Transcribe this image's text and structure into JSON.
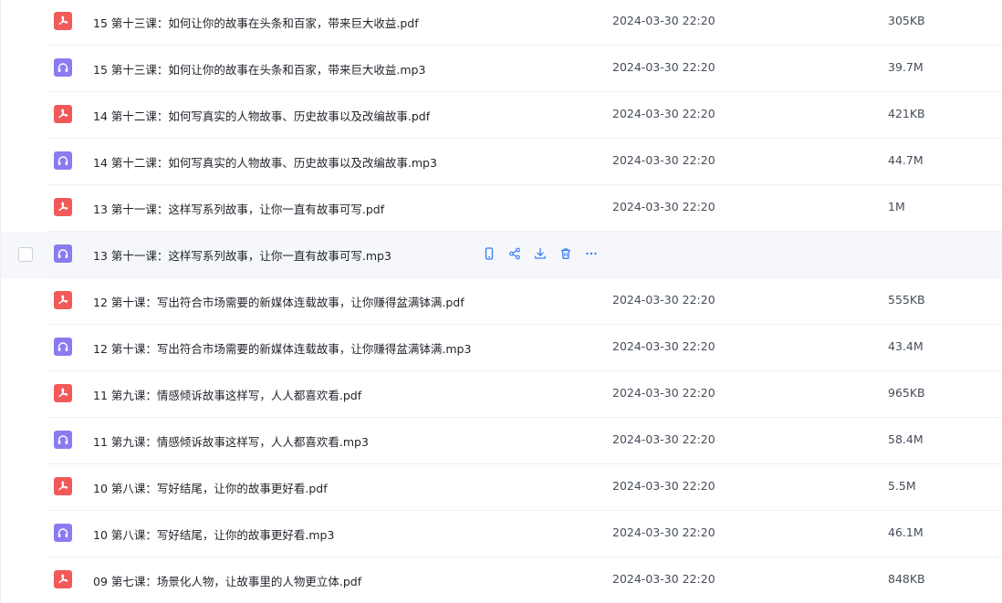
{
  "colors": {
    "pdf_icon": "#f25a5a",
    "audio_icon": "#8a7cf0",
    "action_icon": "#3a7df5"
  },
  "files": [
    {
      "name": "15 第十三课：如何让你的故事在头条和百家，带来巨大收益.pdf",
      "type": "pdf",
      "date": "2024-03-30 22:20",
      "size": "305KB"
    },
    {
      "name": "15 第十三课：如何让你的故事在头条和百家，带来巨大收益.mp3",
      "type": "audio",
      "date": "2024-03-30 22:20",
      "size": "39.7M"
    },
    {
      "name": "14 第十二课：如何写真实的人物故事、历史故事以及改编故事.pdf",
      "type": "pdf",
      "date": "2024-03-30 22:20",
      "size": "421KB"
    },
    {
      "name": "14 第十二课：如何写真实的人物故事、历史故事以及改编故事.mp3",
      "type": "audio",
      "date": "2024-03-30 22:20",
      "size": "44.7M"
    },
    {
      "name": "13 第十一课：这样写系列故事，让你一直有故事可写.pdf",
      "type": "pdf",
      "date": "2024-03-30 22:20",
      "size": "1M"
    },
    {
      "name": "13 第十一课：这样写系列故事，让你一直有故事可写.mp3",
      "type": "audio",
      "date": "",
      "size": "",
      "hover": true
    },
    {
      "name": "12 第十课：写出符合市场需要的新媒体连载故事，让你赚得盆满钵满.pdf",
      "type": "pdf",
      "date": "2024-03-30 22:20",
      "size": "555KB"
    },
    {
      "name": "12 第十课：写出符合市场需要的新媒体连载故事，让你赚得盆满钵满.mp3",
      "type": "audio",
      "date": "2024-03-30 22:20",
      "size": "43.4M"
    },
    {
      "name": "11 第九课：情感倾诉故事这样写，人人都喜欢看.pdf",
      "type": "pdf",
      "date": "2024-03-30 22:20",
      "size": "965KB"
    },
    {
      "name": "11 第九课：情感倾诉故事这样写，人人都喜欢看.mp3",
      "type": "audio",
      "date": "2024-03-30 22:20",
      "size": "58.4M"
    },
    {
      "name": "10 第八课：写好结尾，让你的故事更好看.pdf",
      "type": "pdf",
      "date": "2024-03-30 22:20",
      "size": "5.5M"
    },
    {
      "name": "10 第八课：写好结尾，让你的故事更好看.mp3",
      "type": "audio",
      "date": "2024-03-30 22:20",
      "size": "46.1M"
    },
    {
      "name": "09 第七课：场景化人物，让故事里的人物更立体.pdf",
      "type": "pdf",
      "date": "2024-03-30 22:20",
      "size": "848KB"
    }
  ],
  "row_actions": [
    {
      "icon": "phone-icon"
    },
    {
      "icon": "share-icon"
    },
    {
      "icon": "download-icon"
    },
    {
      "icon": "delete-icon"
    },
    {
      "icon": "more-icon"
    }
  ]
}
